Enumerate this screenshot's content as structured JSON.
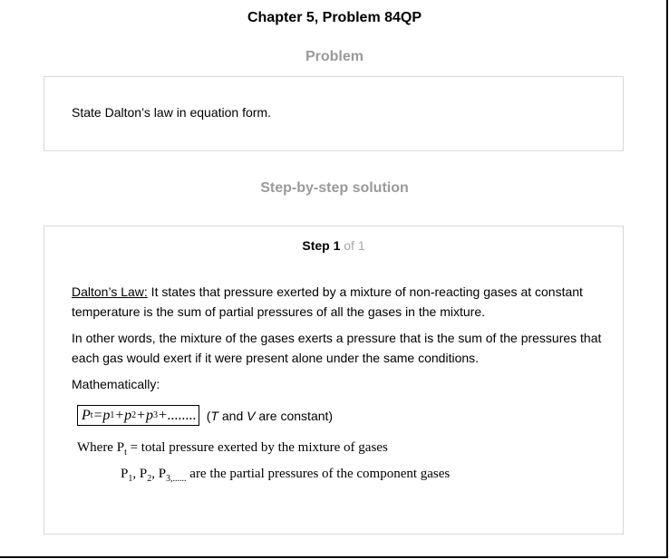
{
  "document": {
    "title": "Chapter 5, Problem 84QP"
  },
  "problem": {
    "heading": "Problem",
    "text": "State Dalton’s law in equation form."
  },
  "solution": {
    "heading": "Step-by-step solution",
    "step": {
      "label": "Step 1",
      "total": "of 1"
    },
    "para1": {
      "term": "Dalton’s Law:",
      "text": " It states that pressure exerted by a mixture of non-reacting gases at constant temperature is the sum of partial pressures of all the gases in the mixture."
    },
    "para2": "In other words, the mixture of the gases exerts a pressure that is the sum of the pressures that each gas would exert if it were present alone under the same conditions.",
    "para3": "Mathematically:",
    "equation": {
      "lhs": "P",
      "lhs_sub": "t",
      "p": "p",
      "sub1": "1",
      "sub2": "2",
      "sub3": "3",
      "op_equals": " = ",
      "op_plus": " + ",
      "tail": "........",
      "note_open": "(",
      "note_T": "T",
      "note_and": " and ",
      "note_V": "V",
      "note_close": " are constant)"
    },
    "where": {
      "prefix": "Where P",
      "sub": "t",
      "text": " = total pressure exerted by the mixture of gases"
    },
    "partials": {
      "p": "P",
      "sub1": "1",
      "sub2": "2",
      "sub3": "3,......",
      "sep": ", ",
      "text": " are the partial pressures of the component gases"
    }
  }
}
